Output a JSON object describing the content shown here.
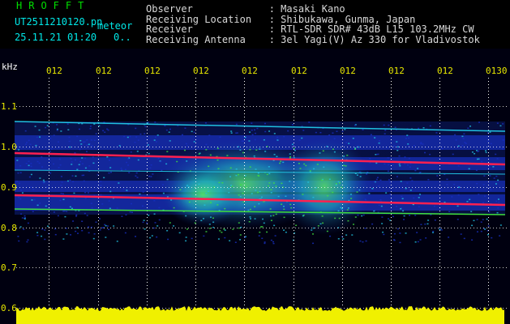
{
  "header": {
    "app_title": "HROFFT",
    "filename": "UT2511210120.pn",
    "meteor_label": "meteor",
    "datetime": "25.11.21 01:20",
    "count": "0..",
    "info_lines": [
      "Observer             : Masaki Kano",
      "Receiving Location   : Shibukawa, Gunma, Japan",
      "Receiver             : RTL-SDR SDR# 43dB L15 103.2MHz CW",
      "Receiving Antenna    : 3el Yagi(V) Az 330 for Vladivostok"
    ]
  },
  "axis": {
    "unit": "kHz",
    "y_ticks": [
      "1.1",
      "1.0",
      "0.9",
      "0.8",
      "0.7",
      "0.6"
    ],
    "time_labels": [
      "012",
      "012",
      "012",
      "012",
      "012",
      "012",
      "012",
      "012",
      "012",
      "0130"
    ]
  },
  "colors": {
    "background": "#000010",
    "grid_dot": "#ffffff",
    "tick_text": "#e8e800",
    "axis_text": "#ffffff",
    "noise_bar": "#f0f000",
    "carrier": "#ff2050",
    "band_blue": "#1830c0",
    "band_cyan": "#20c0e0",
    "band_green": "#40e040"
  }
}
